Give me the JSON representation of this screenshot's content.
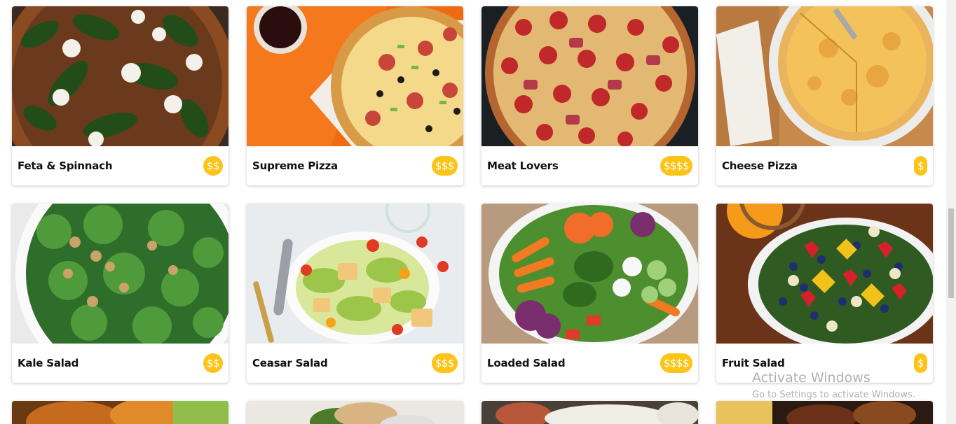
{
  "menu": {
    "items": [
      {
        "name": "Feta & Spinnach",
        "price": "$$"
      },
      {
        "name": "Supreme Pizza",
        "price": "$$$"
      },
      {
        "name": "Meat Lovers",
        "price": "$$$$"
      },
      {
        "name": "Cheese Pizza",
        "price": "$"
      },
      {
        "name": "Kale Salad",
        "price": "$$"
      },
      {
        "name": "Ceasar Salad",
        "price": "$$$"
      },
      {
        "name": "Loaded Salad",
        "price": "$$$$"
      },
      {
        "name": "Fruit Salad",
        "price": "$"
      }
    ]
  },
  "watermark": {
    "title": "Activate Windows",
    "subtitle": "Go to Settings to activate Windows."
  },
  "colors": {
    "price_badge": "#fcc419"
  }
}
